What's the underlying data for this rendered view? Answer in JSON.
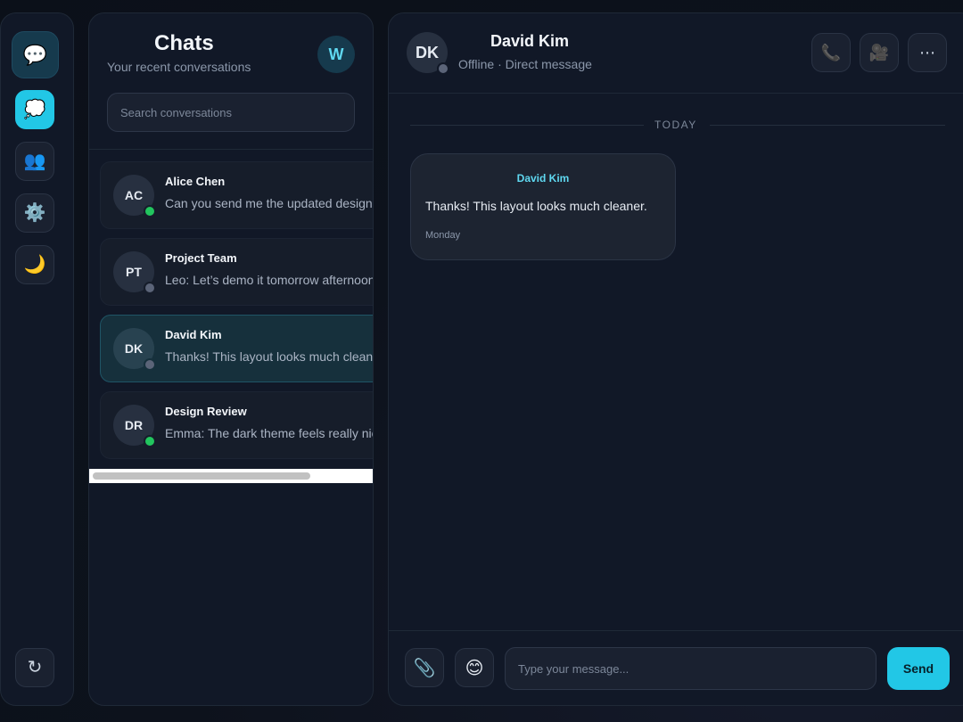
{
  "rail": {
    "items": [
      {
        "icon": "speech-bubble-icon",
        "glyph": "💬"
      },
      {
        "icon": "thought-bubble-icon",
        "glyph": "💭"
      },
      {
        "icon": "people-icon",
        "glyph": "👥"
      },
      {
        "icon": "gear-icon",
        "glyph": "⚙️"
      },
      {
        "icon": "moon-icon",
        "glyph": "🌙"
      }
    ],
    "bottom": {
      "icon": "refresh-icon",
      "glyph": "↻"
    }
  },
  "sidebar": {
    "title": "Chats",
    "subtitle": "Your recent conversations",
    "user_initial": "W",
    "search_placeholder": "Search conversations",
    "conversations": [
      {
        "initials": "AC",
        "name": "Alice Chen",
        "preview": "Can you send me the updated design",
        "status": "online"
      },
      {
        "initials": "PT",
        "name": "Project Team",
        "preview": "Leo: Let’s demo it tomorrow afternoon",
        "status": "offline"
      },
      {
        "initials": "DK",
        "name": "David Kim",
        "preview": "Thanks! This layout looks much cleaner.",
        "status": "offline",
        "selected": true
      },
      {
        "initials": "DR",
        "name": "Design Review",
        "preview": "Emma: The dark theme feels really nice",
        "status": "online"
      }
    ]
  },
  "chat": {
    "initials": "DK",
    "name": "David Kim",
    "status": "Offline · Direct message",
    "actions": [
      {
        "icon": "phone-icon",
        "glyph": "📞"
      },
      {
        "icon": "video-camera-icon",
        "glyph": "🎥"
      },
      {
        "icon": "more-icon",
        "glyph": "⋯"
      }
    ],
    "day_label": "TODAY",
    "messages": [
      {
        "sender": "David Kim",
        "text": "Thanks! This layout looks much cleaner.",
        "time": "Monday"
      }
    ],
    "composer": {
      "attach_glyph": "📎",
      "emoji_glyph": "😊",
      "placeholder": "Type your message...",
      "send_label": "Send"
    }
  },
  "colors": {
    "accent": "#22c7e6",
    "online": "#22c55e",
    "offline": "#5b6478",
    "panel": "#111827"
  }
}
